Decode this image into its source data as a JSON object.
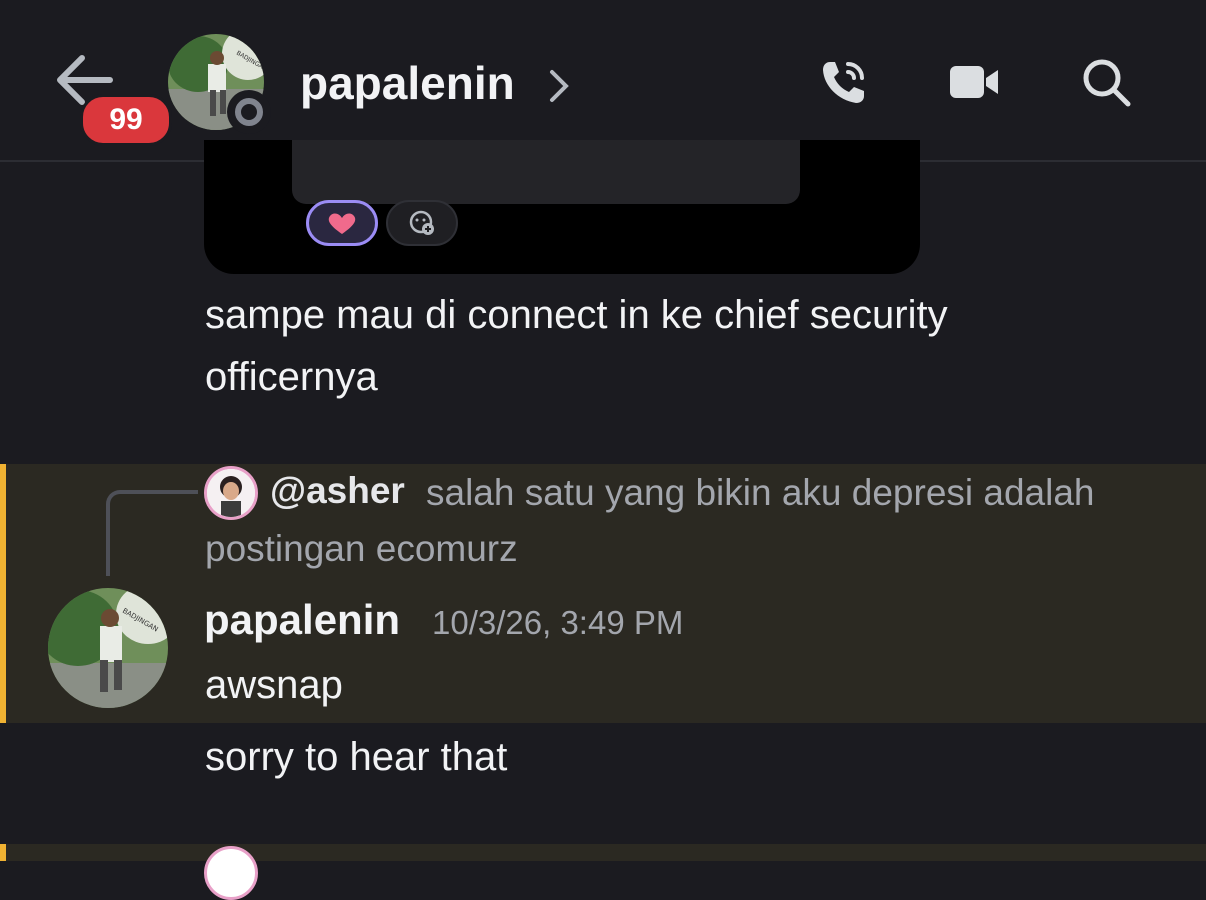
{
  "header": {
    "back_icon": "arrow-left-icon",
    "unread_count": "99",
    "title": "papalenin",
    "avatar_caption": "BADJINGAN",
    "icons": [
      "phone-icon",
      "video-camera-icon",
      "search-icon"
    ]
  },
  "messages": {
    "continued_text_line1": "sampe mau di connect in ke chief security",
    "continued_text_line2": "officernya",
    "reply": {
      "author": "@asher",
      "text_line1": "salah satu yang bikin aku depresi adalah",
      "text_line2": "postingan ecomurz"
    },
    "main": {
      "author": "papalenin",
      "timestamp": "10/3/26, 3:49 PM",
      "text": "awsnap"
    },
    "followup_text": "sorry to hear that"
  },
  "colors": {
    "background": "#1b1b20",
    "highlight_bg": "#2b2922",
    "highlight_bar": "#f0b232",
    "badge": "#da373c",
    "reaction_border": "#9b8cf5"
  }
}
